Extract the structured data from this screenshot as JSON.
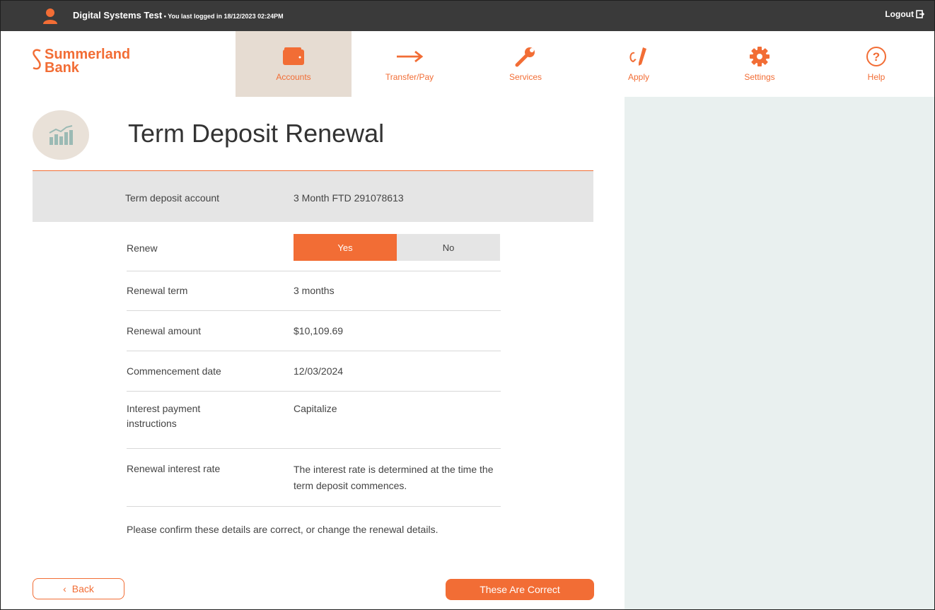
{
  "topbar": {
    "user_name": "Digital Systems Test",
    "last_login": " • You last logged in 18/12/2023 02:24PM",
    "logout_label": "Logout"
  },
  "brand": {
    "line1": "Summerland",
    "line2": "Bank",
    "color": "#f26d35"
  },
  "nav": {
    "accounts": "Accounts",
    "transfer": "Transfer/Pay",
    "services": "Services",
    "apply": "Apply",
    "settings": "Settings",
    "help": "Help"
  },
  "page": {
    "title": "Term Deposit Renewal"
  },
  "account": {
    "label": "Term deposit account",
    "value": "3 Month FTD 291078613"
  },
  "renew": {
    "label": "Renew",
    "yes": "Yes",
    "no": "No",
    "selected": "Yes"
  },
  "details": {
    "term_label": "Renewal term",
    "term_value": "3 months",
    "amount_label": "Renewal amount",
    "amount_value": "$10,109.69",
    "date_label": "Commencement date",
    "date_value": "12/03/2024",
    "interest_label": "Interest payment instructions",
    "interest_value": "Capitalize",
    "rate_label": "Renewal interest rate",
    "rate_value": "The interest rate is determined at the time the term deposit commences."
  },
  "confirm_text": "Please confirm these details are correct, or change the renewal details.",
  "buttons": {
    "back": "Back",
    "confirm": "These Are Correct"
  },
  "colors": {
    "accent": "#f26d35",
    "topbar": "#3a3a3a",
    "active_nav": "#e6dcd2",
    "side_panel": "#e9f0ef"
  }
}
